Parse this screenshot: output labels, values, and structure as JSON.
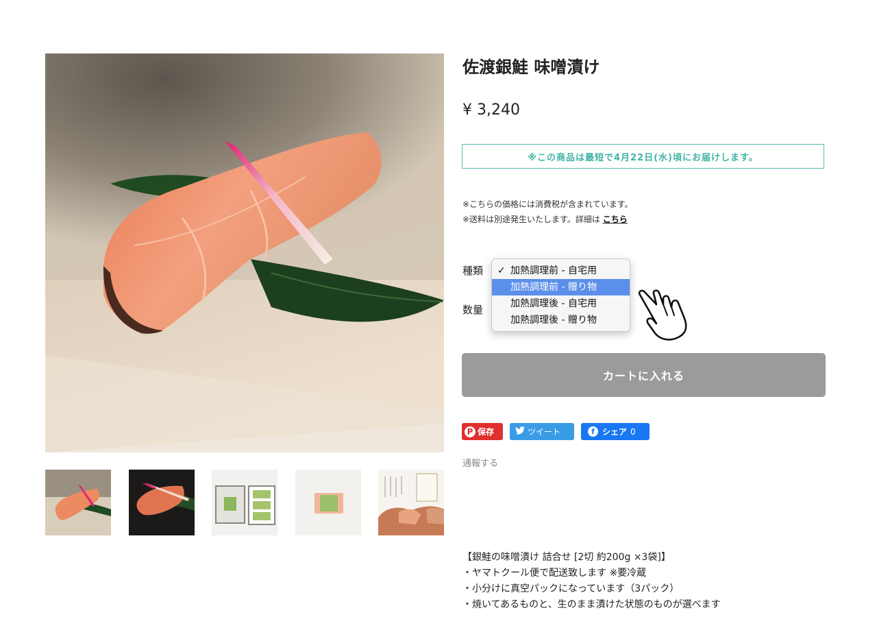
{
  "product": {
    "title": "佐渡銀鮭 味噌漬け",
    "price": "¥ 3,240",
    "delivery_notice": "※この商品は最短で4月22日(水)頃にお届けします。",
    "tax_note": "※こちらの価格には消費税が含まれています。",
    "shipping_note": "※送料は別途発生いたします。詳細は",
    "shipping_link": "こちら"
  },
  "options": {
    "type_label": "種類",
    "qty_label": "数量",
    "dropdown_items": [
      "加熱調理前 - 自宅用",
      "加熱調理前 - 贈り物",
      "加熱調理後 - 自宅用",
      "加熱調理後 - 贈り物"
    ],
    "checked_index": 0,
    "highlighted_index": 1,
    "check_mark": "✓"
  },
  "cart": {
    "label": "カートに入れる"
  },
  "share": {
    "pinterest_label": "保存",
    "twitter_label": "ツイート",
    "facebook_label": "シェア",
    "facebook_count": "0"
  },
  "report_label": "通報する",
  "description": [
    "【銀鮭の味噌漬け 詰合せ [2切 約200g ×3袋]】",
    "・ヤマトクール便で配送致します ※要冷蔵",
    "・小分けに真空パックになっています（3パック）",
    "・焼いてあるものと、生のまま漬けた状態のものが選べます"
  ],
  "colors": {
    "accent_teal": "#3fb3a5",
    "cart_button": "#9b9b9b",
    "dropdown_highlight": "#5b8fea",
    "pinterest": "#e02f2f",
    "twitter": "#3b9ce6",
    "facebook": "#1877f2"
  },
  "icons": [
    "pinterest-icon",
    "twitter-icon",
    "facebook-icon",
    "hand-pointer-icon",
    "checkmark-icon"
  ]
}
